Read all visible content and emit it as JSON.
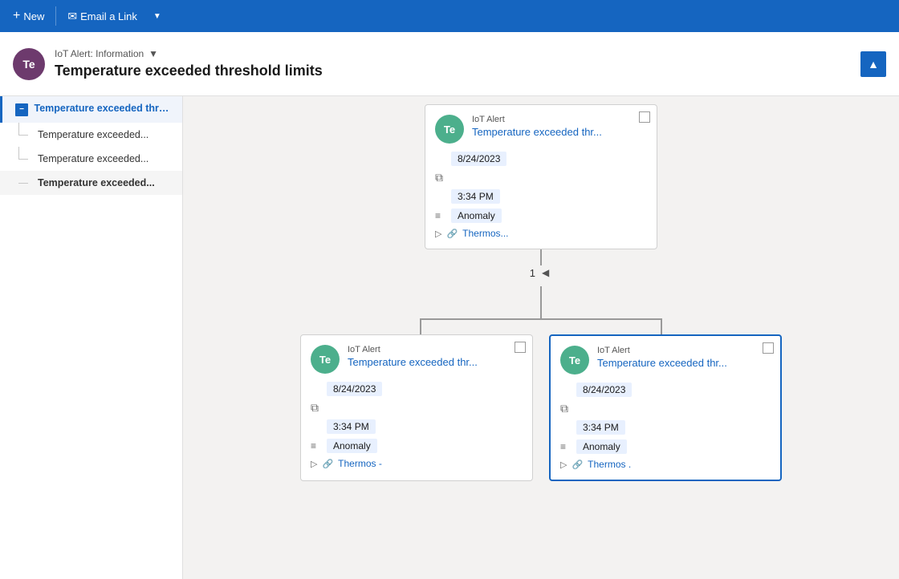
{
  "topbar": {
    "new_label": "New",
    "email_label": "Email a Link"
  },
  "header": {
    "avatar_initials": "Te",
    "dropdown_label": "IoT Alert: Information",
    "title": "Temperature exceeded threshold limits",
    "collapse_icon": "▲"
  },
  "sidebar": {
    "items": [
      {
        "label": "Temperature exceeded thresh...",
        "level": "parent",
        "state": "active"
      },
      {
        "label": "Temperature exceeded...",
        "level": "child"
      },
      {
        "label": "Temperature exceeded...",
        "level": "child"
      },
      {
        "label": "Temperature exceeded...",
        "level": "child",
        "selected": true
      }
    ]
  },
  "main": {
    "top_card": {
      "avatar": "Te",
      "type": "IoT Alert",
      "name": "Temperature exceeded thr...",
      "date": "8/24/2023",
      "time": "3:34 PM",
      "category": "Anomaly",
      "link": "Thermos..."
    },
    "pagination": {
      "page": "1"
    },
    "bottom_cards": [
      {
        "avatar": "Te",
        "type": "IoT Alert",
        "name": "Temperature exceeded thr...",
        "date": "8/24/2023",
        "time": "3:34 PM",
        "category": "Anomaly",
        "link": "Thermos -",
        "selected": false
      },
      {
        "avatar": "Te",
        "type": "IoT Alert",
        "name": "Temperature exceeded thr...",
        "date": "8/24/2023",
        "time": "3:34 PM",
        "category": "Anomaly",
        "link": "Thermos .",
        "selected": true
      }
    ]
  }
}
